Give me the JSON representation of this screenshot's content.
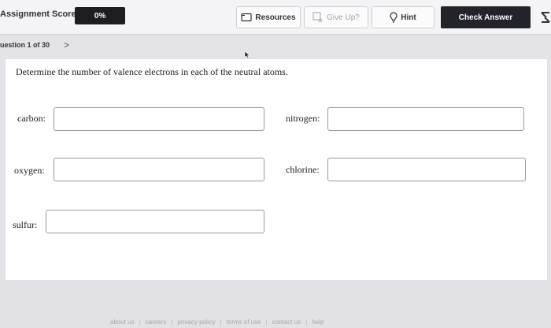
{
  "header": {
    "score_label": "Assignment Score:",
    "score_value": "0%",
    "resources_label": "Resources",
    "give_up_label": "Give Up?",
    "hint_label": "Hint",
    "check_answer_label": "Check Answer",
    "icons": [
      "resources-icon",
      "give-up-icon",
      "hint-icon",
      "expand-icon"
    ]
  },
  "question_nav": {
    "text": "uestion 1 of 30",
    "next_glyph": ">"
  },
  "question": {
    "prompt": "Determine the number of valence electrons in each of the neutral atoms.",
    "fields": [
      {
        "label": "carbon:",
        "value": ""
      },
      {
        "label": "nitrogen:",
        "value": ""
      },
      {
        "label": "oxygen:",
        "value": ""
      },
      {
        "label": "chlorine:",
        "value": ""
      },
      {
        "label": "sulfur:",
        "value": ""
      }
    ]
  },
  "footer": {
    "links": [
      "about us",
      "careers",
      "privacy policy",
      "terms of use",
      "contact us",
      "help"
    ]
  },
  "colors": {
    "page_bg": "#e4e4e8",
    "panel_bg": "#ffffff",
    "dark_button": "#23232a"
  }
}
